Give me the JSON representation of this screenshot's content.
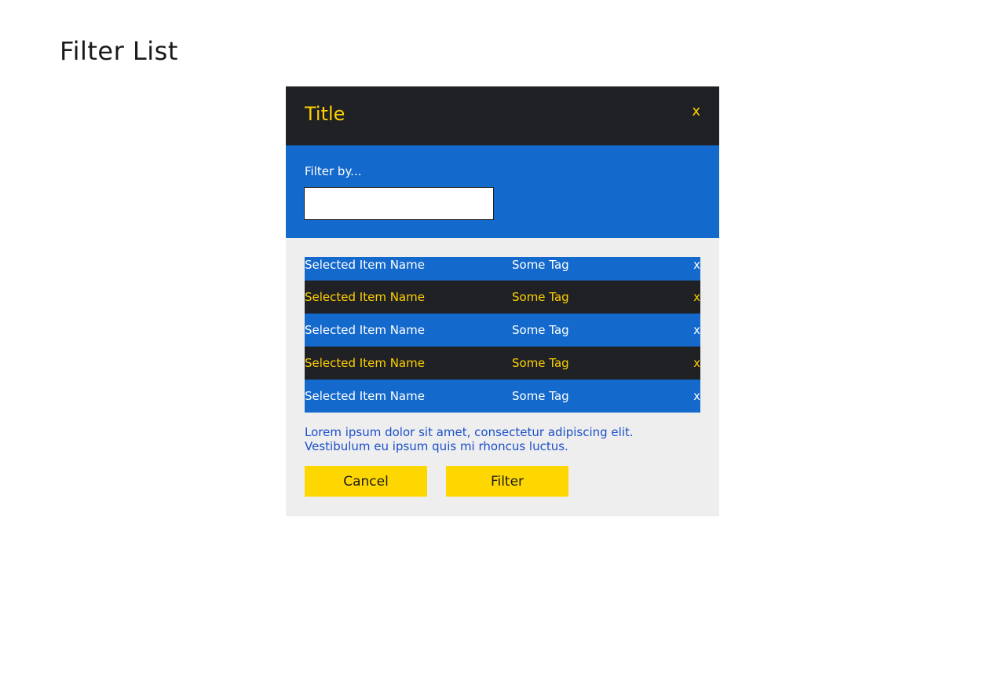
{
  "page": {
    "title": "Filter List"
  },
  "modal": {
    "title": "Title",
    "close_label": "x",
    "filter_label": "Filter by...",
    "filter_value": "",
    "filter_placeholder": "",
    "items": [
      {
        "name": "Selected Item Name",
        "tag": "Some Tag",
        "remove_label": "x",
        "style": "blue"
      },
      {
        "name": "Selected Item Name",
        "tag": "Some Tag",
        "remove_label": "x",
        "style": "dark"
      },
      {
        "name": "Selected Item Name",
        "tag": "Some Tag",
        "remove_label": "x",
        "style": "blue"
      },
      {
        "name": "Selected Item Name",
        "tag": "Some Tag",
        "remove_label": "x",
        "style": "dark"
      },
      {
        "name": "Selected Item Name",
        "tag": "Some Tag",
        "remove_label": "x",
        "style": "blue"
      }
    ],
    "description": "Lorem ipsum dolor sit amet, consectetur adipiscing elit. Vestibulum eu ipsum quis mi rhoncus luctus.",
    "cancel_label": "Cancel",
    "filter_button_label": "Filter"
  },
  "colors": {
    "header_bg": "#202124",
    "accent_yellow": "#ffd000",
    "primary_blue": "#1469cc",
    "panel_bg": "#eeeeee",
    "button_yellow": "#ffd700",
    "description_text": "#1a4fcc"
  }
}
